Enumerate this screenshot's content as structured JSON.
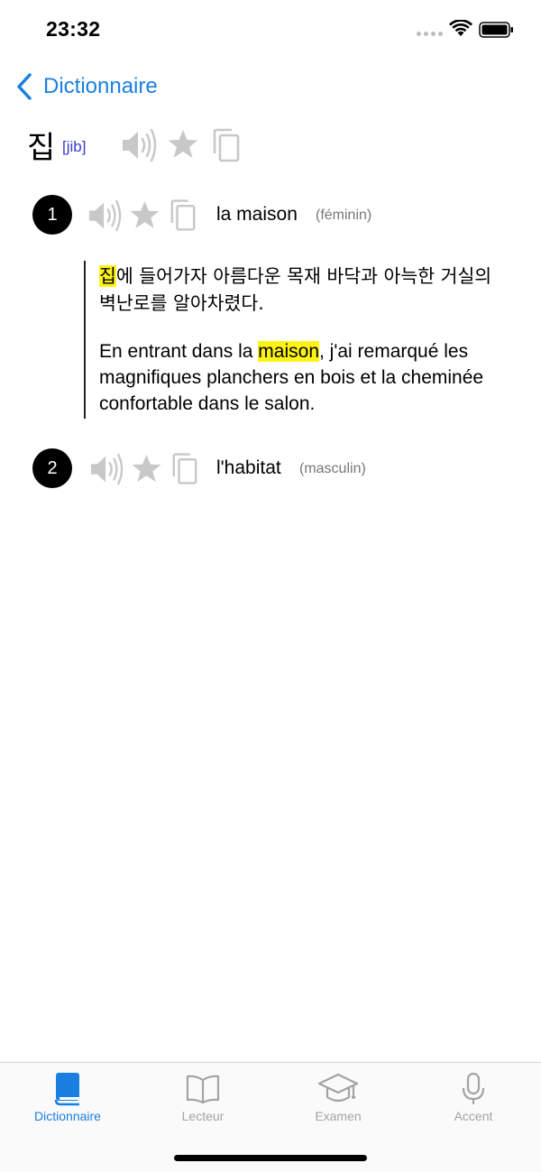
{
  "status_bar": {
    "time": "23:32"
  },
  "nav": {
    "back_label": "Dictionnaire"
  },
  "entry": {
    "headword": "집",
    "romanization": "[jib]"
  },
  "senses": [
    {
      "number": "1",
      "translation": "la maison",
      "gender": "(féminin)",
      "example": {
        "ko_highlight": "집",
        "ko_rest": "에 들어가자 아름다운 목재 바닥과 아늑한 거실의 벽난로를 알아차렸다.",
        "fr_before": "En entrant dans la ",
        "fr_highlight": "maison",
        "fr_after": ", j'ai remarqué les magnifiques planchers en bois et la cheminée confortable dans le salon."
      }
    },
    {
      "number": "2",
      "translation": "l'habitat",
      "gender": "(masculin)"
    }
  ],
  "tabs": [
    {
      "label": "Dictionnaire",
      "icon": "book-icon",
      "active": true
    },
    {
      "label": "Lecteur",
      "icon": "open-book-icon",
      "active": false
    },
    {
      "label": "Examen",
      "icon": "graduation-cap-icon",
      "active": false
    },
    {
      "label": "Accent",
      "icon": "microphone-icon",
      "active": false
    }
  ],
  "colors": {
    "accent": "#1a7fe0",
    "highlight": "#fdf316",
    "romanization": "#3a3acd",
    "inactive_icon": "#c8c8c8"
  }
}
